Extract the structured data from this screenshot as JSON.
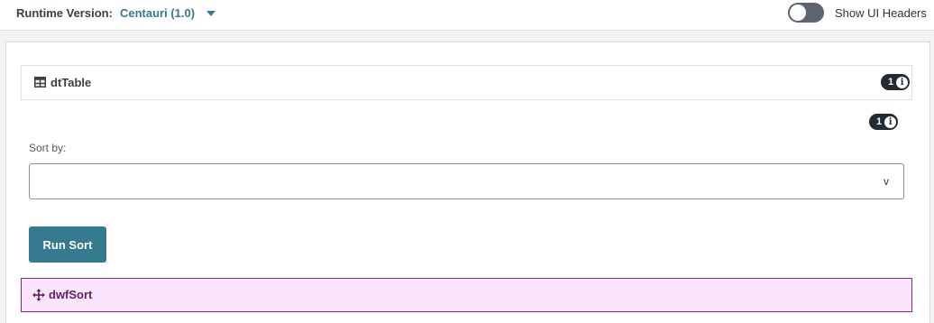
{
  "topbar": {
    "runtime_label": "Runtime Version:",
    "runtime_value": "Centauri (1.0)",
    "toggle_label": "Show UI Headers",
    "toggle_on": false
  },
  "component": {
    "title": "dtTable",
    "icon": "table-icon",
    "badge_count": "1",
    "badge_icon": "info-icon"
  },
  "sort_section": {
    "badge_count": "1",
    "label": "Sort by:",
    "select_value": "",
    "chevron": "v",
    "run_button": "Run Sort"
  },
  "dwf": {
    "title": "dwfSort",
    "icon": "move-icon"
  },
  "colors": {
    "accent": "#357a8f",
    "badge": "#222a33",
    "dwf_background": "#fbe5fc",
    "dwf_border": "#7f2c85"
  }
}
